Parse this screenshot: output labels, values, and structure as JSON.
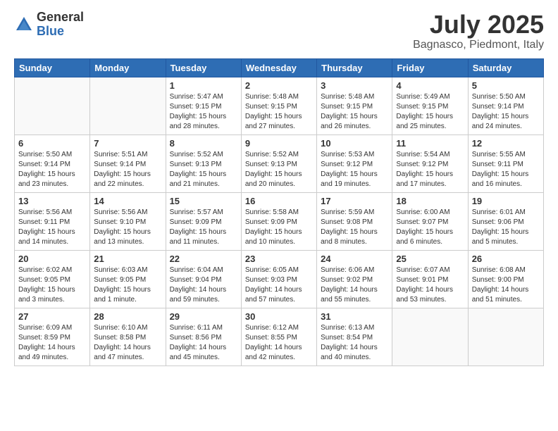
{
  "header": {
    "logo_general": "General",
    "logo_blue": "Blue",
    "title": "July 2025",
    "location": "Bagnasco, Piedmont, Italy"
  },
  "days_of_week": [
    "Sunday",
    "Monday",
    "Tuesday",
    "Wednesday",
    "Thursday",
    "Friday",
    "Saturday"
  ],
  "weeks": [
    [
      {
        "day": "",
        "info": ""
      },
      {
        "day": "",
        "info": ""
      },
      {
        "day": "1",
        "info": "Sunrise: 5:47 AM\nSunset: 9:15 PM\nDaylight: 15 hours\nand 28 minutes."
      },
      {
        "day": "2",
        "info": "Sunrise: 5:48 AM\nSunset: 9:15 PM\nDaylight: 15 hours\nand 27 minutes."
      },
      {
        "day": "3",
        "info": "Sunrise: 5:48 AM\nSunset: 9:15 PM\nDaylight: 15 hours\nand 26 minutes."
      },
      {
        "day": "4",
        "info": "Sunrise: 5:49 AM\nSunset: 9:15 PM\nDaylight: 15 hours\nand 25 minutes."
      },
      {
        "day": "5",
        "info": "Sunrise: 5:50 AM\nSunset: 9:14 PM\nDaylight: 15 hours\nand 24 minutes."
      }
    ],
    [
      {
        "day": "6",
        "info": "Sunrise: 5:50 AM\nSunset: 9:14 PM\nDaylight: 15 hours\nand 23 minutes."
      },
      {
        "day": "7",
        "info": "Sunrise: 5:51 AM\nSunset: 9:14 PM\nDaylight: 15 hours\nand 22 minutes."
      },
      {
        "day": "8",
        "info": "Sunrise: 5:52 AM\nSunset: 9:13 PM\nDaylight: 15 hours\nand 21 minutes."
      },
      {
        "day": "9",
        "info": "Sunrise: 5:52 AM\nSunset: 9:13 PM\nDaylight: 15 hours\nand 20 minutes."
      },
      {
        "day": "10",
        "info": "Sunrise: 5:53 AM\nSunset: 9:12 PM\nDaylight: 15 hours\nand 19 minutes."
      },
      {
        "day": "11",
        "info": "Sunrise: 5:54 AM\nSunset: 9:12 PM\nDaylight: 15 hours\nand 17 minutes."
      },
      {
        "day": "12",
        "info": "Sunrise: 5:55 AM\nSunset: 9:11 PM\nDaylight: 15 hours\nand 16 minutes."
      }
    ],
    [
      {
        "day": "13",
        "info": "Sunrise: 5:56 AM\nSunset: 9:11 PM\nDaylight: 15 hours\nand 14 minutes."
      },
      {
        "day": "14",
        "info": "Sunrise: 5:56 AM\nSunset: 9:10 PM\nDaylight: 15 hours\nand 13 minutes."
      },
      {
        "day": "15",
        "info": "Sunrise: 5:57 AM\nSunset: 9:09 PM\nDaylight: 15 hours\nand 11 minutes."
      },
      {
        "day": "16",
        "info": "Sunrise: 5:58 AM\nSunset: 9:09 PM\nDaylight: 15 hours\nand 10 minutes."
      },
      {
        "day": "17",
        "info": "Sunrise: 5:59 AM\nSunset: 9:08 PM\nDaylight: 15 hours\nand 8 minutes."
      },
      {
        "day": "18",
        "info": "Sunrise: 6:00 AM\nSunset: 9:07 PM\nDaylight: 15 hours\nand 6 minutes."
      },
      {
        "day": "19",
        "info": "Sunrise: 6:01 AM\nSunset: 9:06 PM\nDaylight: 15 hours\nand 5 minutes."
      }
    ],
    [
      {
        "day": "20",
        "info": "Sunrise: 6:02 AM\nSunset: 9:05 PM\nDaylight: 15 hours\nand 3 minutes."
      },
      {
        "day": "21",
        "info": "Sunrise: 6:03 AM\nSunset: 9:05 PM\nDaylight: 15 hours\nand 1 minute."
      },
      {
        "day": "22",
        "info": "Sunrise: 6:04 AM\nSunset: 9:04 PM\nDaylight: 14 hours\nand 59 minutes."
      },
      {
        "day": "23",
        "info": "Sunrise: 6:05 AM\nSunset: 9:03 PM\nDaylight: 14 hours\nand 57 minutes."
      },
      {
        "day": "24",
        "info": "Sunrise: 6:06 AM\nSunset: 9:02 PM\nDaylight: 14 hours\nand 55 minutes."
      },
      {
        "day": "25",
        "info": "Sunrise: 6:07 AM\nSunset: 9:01 PM\nDaylight: 14 hours\nand 53 minutes."
      },
      {
        "day": "26",
        "info": "Sunrise: 6:08 AM\nSunset: 9:00 PM\nDaylight: 14 hours\nand 51 minutes."
      }
    ],
    [
      {
        "day": "27",
        "info": "Sunrise: 6:09 AM\nSunset: 8:59 PM\nDaylight: 14 hours\nand 49 minutes."
      },
      {
        "day": "28",
        "info": "Sunrise: 6:10 AM\nSunset: 8:58 PM\nDaylight: 14 hours\nand 47 minutes."
      },
      {
        "day": "29",
        "info": "Sunrise: 6:11 AM\nSunset: 8:56 PM\nDaylight: 14 hours\nand 45 minutes."
      },
      {
        "day": "30",
        "info": "Sunrise: 6:12 AM\nSunset: 8:55 PM\nDaylight: 14 hours\nand 42 minutes."
      },
      {
        "day": "31",
        "info": "Sunrise: 6:13 AM\nSunset: 8:54 PM\nDaylight: 14 hours\nand 40 minutes."
      },
      {
        "day": "",
        "info": ""
      },
      {
        "day": "",
        "info": ""
      }
    ]
  ]
}
